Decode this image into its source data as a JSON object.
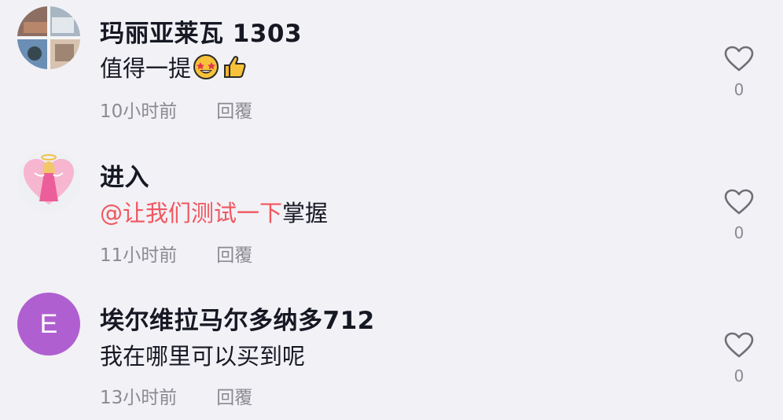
{
  "comments": [
    {
      "username": "玛丽亚莱瓦 1303",
      "text": "值得一提",
      "emojis": [
        "star-struck-emoji",
        "thumbs-up-emoji"
      ],
      "time": "10小时前",
      "reply": "回覆",
      "likes": "0",
      "avatar": "photo-collage-avatar"
    },
    {
      "username": "进入",
      "mention": "@让我们测试一下",
      "text": "掌握",
      "time": "11小时前",
      "reply": "回覆",
      "likes": "0",
      "avatar": "pink-angel-avatar"
    },
    {
      "username": "埃尔维拉马尔多纳多712",
      "text": "我在哪里可以买到呢",
      "time": "13小时前",
      "reply": "回覆",
      "likes": "0",
      "avatar_letter": "E",
      "avatar_color": "#b05fd0"
    }
  ],
  "colors": {
    "background": "#f2f1f6",
    "text": "#161823",
    "muted": "#8a8b91",
    "mention": "#f0575f",
    "heart_stroke": "#6f7076"
  }
}
